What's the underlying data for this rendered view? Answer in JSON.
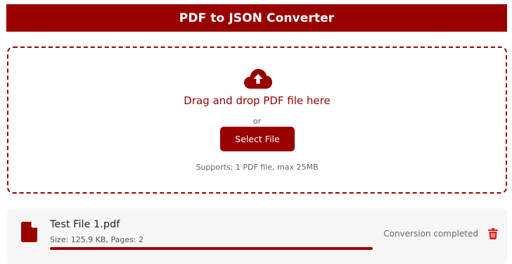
{
  "header": {
    "title": "PDF to JSON Converter"
  },
  "dropzone": {
    "icon": "cloud-upload-icon",
    "title": "Drag and drop PDF file here",
    "or_text": "or",
    "button_label": "Select File",
    "supports_text": "Supports: 1 PDF file, max 25MB"
  },
  "file": {
    "icon": "file-pdf-icon",
    "name": "Test File 1.pdf",
    "meta": "Size: 125.9 KB, Pages: 2",
    "progress_percent": 100,
    "status": "Conversion completed",
    "delete_icon": "trash-icon"
  },
  "colors": {
    "accent": "#990000",
    "card_background": "#f6f6f6",
    "muted_text": "#666666"
  }
}
